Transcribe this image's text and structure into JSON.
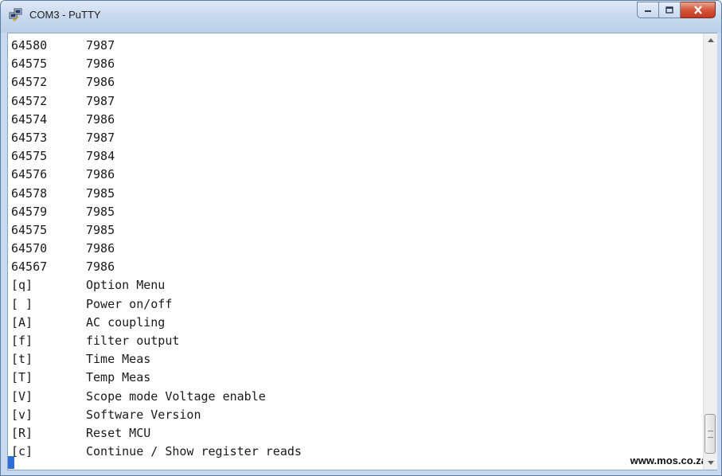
{
  "window": {
    "title": "COM3 - PuTTY",
    "icon": "putty-app-icon"
  },
  "title_controls": {
    "minimize_icon": "minimize-icon",
    "maximize_icon": "maximize-icon",
    "close_icon": "close-icon",
    "close_color": "#c8432a"
  },
  "terminal": {
    "readings": [
      {
        "a": "64580",
        "b": "7987"
      },
      {
        "a": "64575",
        "b": "7986"
      },
      {
        "a": "64572",
        "b": "7986"
      },
      {
        "a": "64572",
        "b": "7987"
      },
      {
        "a": "64574",
        "b": "7986"
      },
      {
        "a": "64573",
        "b": "7987"
      },
      {
        "a": "64575",
        "b": "7984"
      },
      {
        "a": "64576",
        "b": "7986"
      },
      {
        "a": "64578",
        "b": "7985"
      },
      {
        "a": "64579",
        "b": "7985"
      },
      {
        "a": "64575",
        "b": "7985"
      },
      {
        "a": "64570",
        "b": "7986"
      },
      {
        "a": "64567",
        "b": "7986"
      }
    ],
    "menu": [
      {
        "key": "[q]",
        "label": "Option Menu"
      },
      {
        "key": "[ ]",
        "label": "Power on/off"
      },
      {
        "key": "[A]",
        "label": "AC coupling"
      },
      {
        "key": "[f]",
        "label": "filter output"
      },
      {
        "key": "[t]",
        "label": "Time Meas"
      },
      {
        "key": "[T]",
        "label": "Temp Meas"
      },
      {
        "key": "[V]",
        "label": "Scope mode Voltage enable"
      },
      {
        "key": "[v]",
        "label": "Software Version"
      },
      {
        "key": "[R]",
        "label": "Reset MCU"
      },
      {
        "key": "[c]",
        "label": "Continue / Show register reads"
      }
    ],
    "cursor_color": "#2d6fd6"
  },
  "watermark": "www.mos.co.za",
  "scrollbar": {
    "up_icon": "scroll-up-icon",
    "down_icon": "scroll-down-icon",
    "position": 1.0
  }
}
